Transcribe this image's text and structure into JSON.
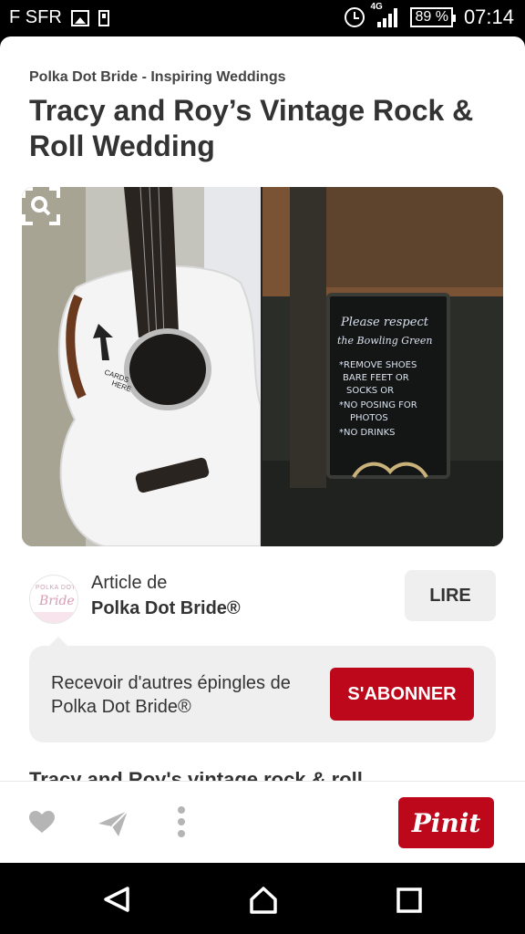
{
  "status_bar": {
    "carrier": "F SFR",
    "network": "4G",
    "battery": "89 %",
    "time": "07:14"
  },
  "pin": {
    "source": "Polka Dot Bride - Inspiring Weddings",
    "title": "Tracy and Roy’s Vintage Rock & Roll Wedding",
    "image_sign": [
      "Please respect",
      "the Bowling Green",
      "*REMOVE SHOES",
      "BARE FEET OR",
      "SOCKS OR",
      "*NO POSING FOR",
      "PHOTOS",
      "*NO DRINKS"
    ],
    "image_guitar_label": [
      "CARDS",
      "HERE"
    ]
  },
  "article": {
    "label": "Article de",
    "author": "Polka Dot Bride®",
    "avatar_text_top": "POLKA DOT",
    "avatar_text_main": "Bride",
    "read_button": "LIRE"
  },
  "subscribe": {
    "text": "Recevoir d'autres épingles de Polka Dot Bride®",
    "button": "S'ABONNER"
  },
  "description": "Tracy and Roy's vintage rock & roll",
  "actions": {
    "pin_button": "Pinit",
    "icons": [
      "heart-icon",
      "send-icon",
      "more-icon"
    ]
  },
  "nav": {
    "icons": [
      "back-icon",
      "home-icon",
      "recents-icon"
    ]
  },
  "colors": {
    "brand_red": "#bd081c",
    "button_gray": "#efefef"
  }
}
